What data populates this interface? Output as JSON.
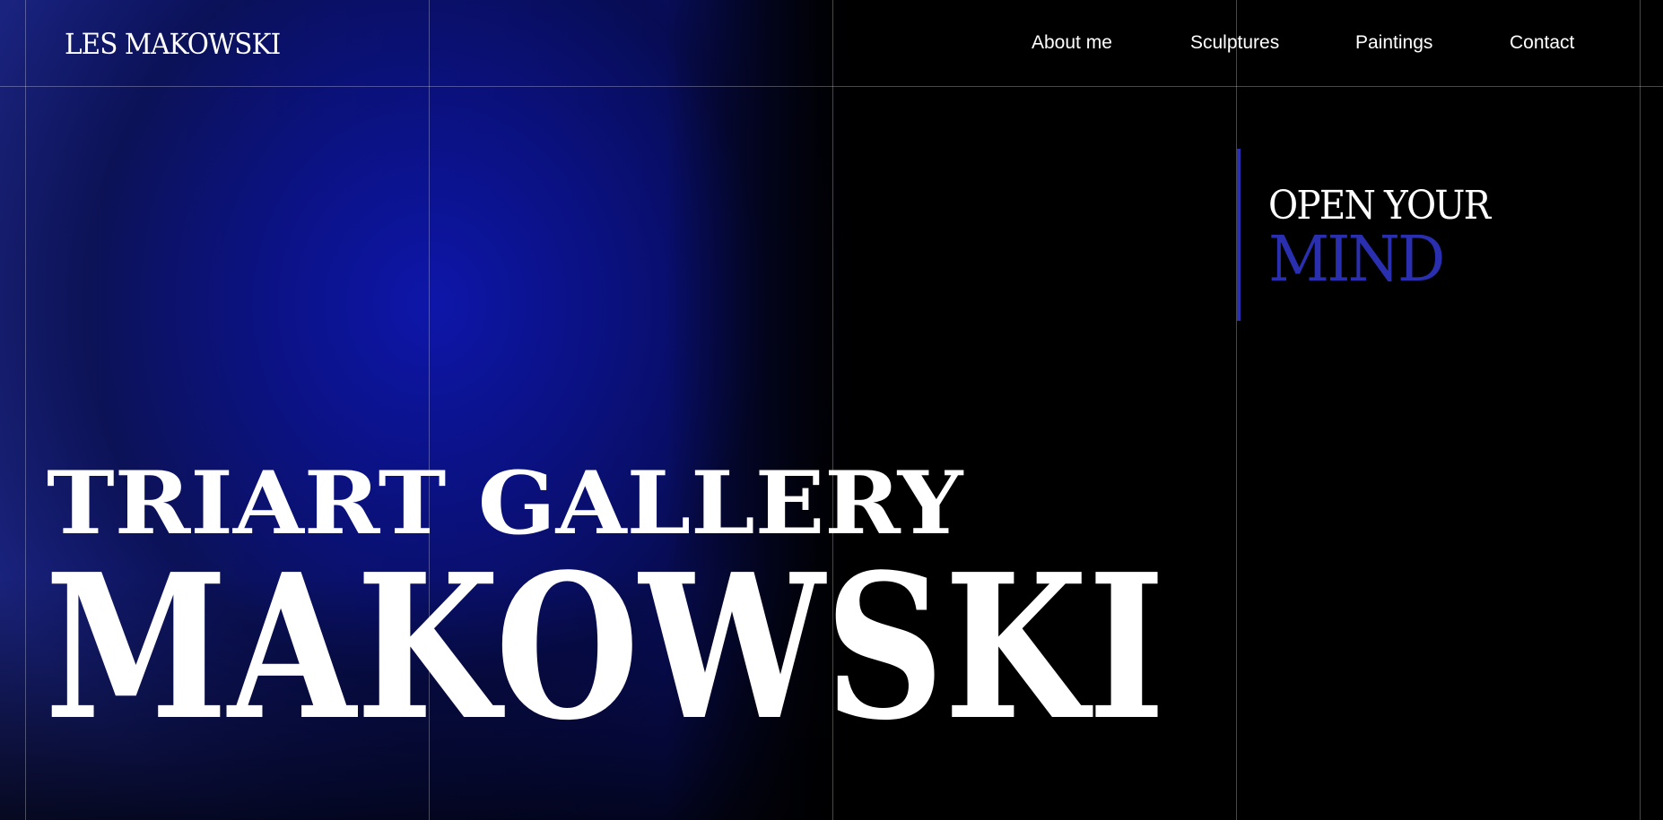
{
  "header": {
    "logo": "LES MAKOWSKI",
    "nav": [
      {
        "label": "About me"
      },
      {
        "label": "Sculptures"
      },
      {
        "label": "Paintings"
      },
      {
        "label": "Contact"
      }
    ]
  },
  "tagline": {
    "line1": "OPEN YOUR",
    "line2": "MIND",
    "accent_color": "#2a2fb0"
  },
  "hero": {
    "line1": "TRIART GALLERY",
    "line2": "MAKOWSKI"
  },
  "colors": {
    "background": "#000000",
    "glow": "#0e16aa",
    "accent": "#2a2fb0",
    "text": "#ffffff"
  }
}
